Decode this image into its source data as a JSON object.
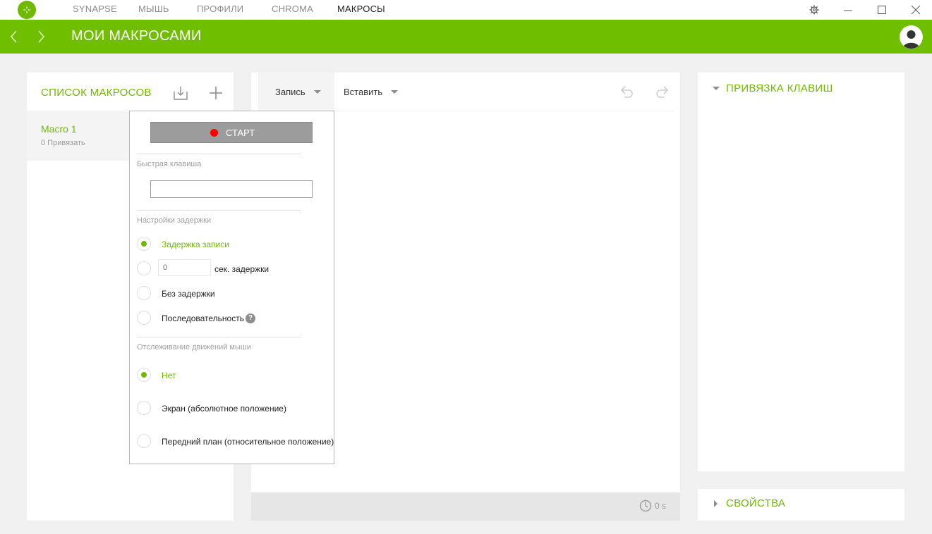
{
  "nav": {
    "tabs": [
      {
        "label": "SYNAPSE",
        "active": false
      },
      {
        "label": "МЫШЬ",
        "active": false
      },
      {
        "label": "ПРОФИЛИ",
        "active": false
      },
      {
        "label": "CHROMA",
        "active": false
      },
      {
        "label": "МАКРОСЫ",
        "active": true
      }
    ],
    "window_icons": [
      "gear-icon",
      "minimize-icon",
      "maximize-icon",
      "close-icon"
    ]
  },
  "header": {
    "title": "МОИ МАКРОСАМИ",
    "back_icon": "chevron-left-icon",
    "forward_icon": "chevron-right-icon",
    "avatar_icon": "user-icon"
  },
  "macro_list": {
    "title": "СПИСОК МАКРОСОВ",
    "items": [
      {
        "name": "Macro 1",
        "sub": "0 Привязать"
      }
    ]
  },
  "editor": {
    "record_label": "Запись",
    "insert_label": "Вставить",
    "timer_value": "0 s"
  },
  "keybind": {
    "title": "ПРИВЯЗКА КЛАВИШ"
  },
  "properties": {
    "title": "СВОЙСТВА"
  },
  "record_popup": {
    "start_label": "СТАРТ",
    "hotkey_section": "Быстрая клавиша",
    "hotkey_value": "",
    "delay_section": "Настройки задержки",
    "delay_options": {
      "record": "Задержка записи",
      "seconds_suffix": "сек. задержки",
      "none": "Без задержки",
      "sequence": "Последовательность"
    },
    "seconds_placeholder": "0",
    "mouse_section": "Отслеживание движений мыши",
    "mouse_options": {
      "none": "Нет",
      "screen": "Экран (абсолютное положение)",
      "foreground": "Передний план (относительное положение)"
    },
    "help_glyph": "?"
  },
  "colors": {
    "accent": "#6fb900",
    "header": "#6fbe00",
    "background": "#f1f1f1",
    "record_dot": "#ff0000"
  }
}
